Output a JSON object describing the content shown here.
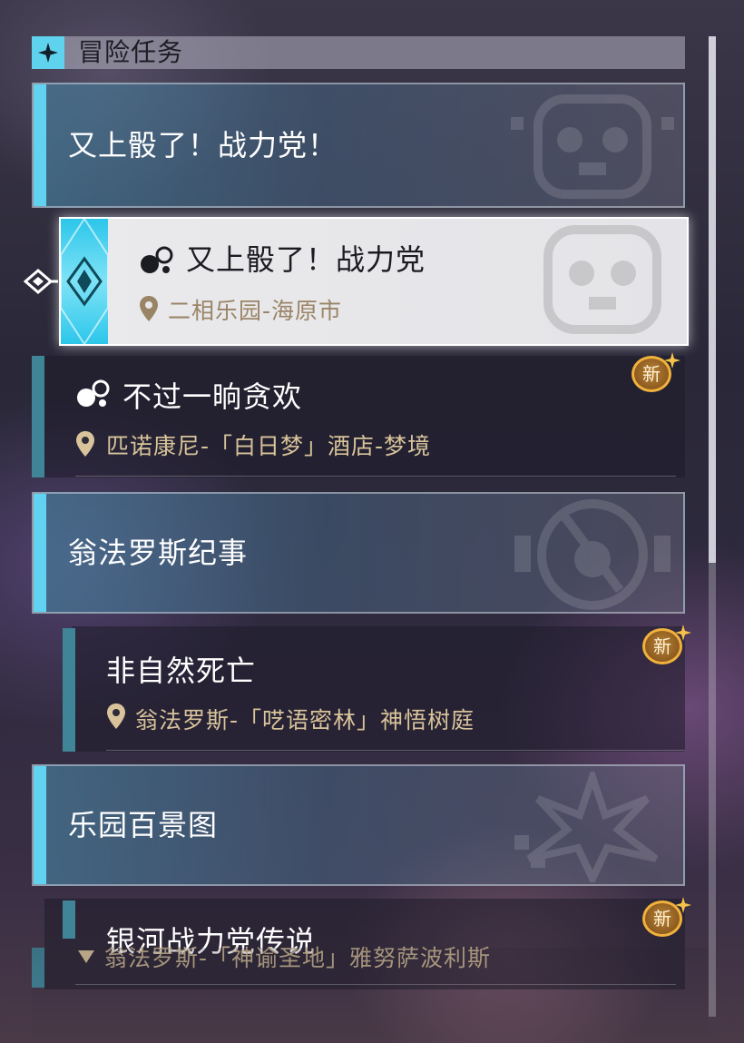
{
  "header": {
    "title": "冒险任务",
    "icon": "diamond-star-icon",
    "accent": "#5fd2ee"
  },
  "groups": [
    {
      "title": "又上骰了！战力党！"
    },
    {
      "title": "翁法罗斯纪事"
    },
    {
      "title": "乐园百景图"
    }
  ],
  "selected_quest": {
    "title": "又上骰了！战力党",
    "location": "二相乐园-海原市",
    "icon": "quest-type-icon"
  },
  "quests": [
    {
      "title": "不过一晌贪欢",
      "location": "匹诺康尼-「白日梦」酒店-梦境",
      "badge": "新"
    },
    {
      "title": "非自然死亡",
      "location": "翁法罗斯-「呓语密林」神悟树庭",
      "badge": "新"
    },
    {
      "title": "银河战力党传说",
      "location": "翁法罗斯-「神谕圣地」雅努萨波利斯",
      "badge": "新"
    }
  ],
  "colors": {
    "accent_cyan": "#61d3f0",
    "location_gold": "#d8c39a",
    "badge_gold": "#f0b23c"
  }
}
